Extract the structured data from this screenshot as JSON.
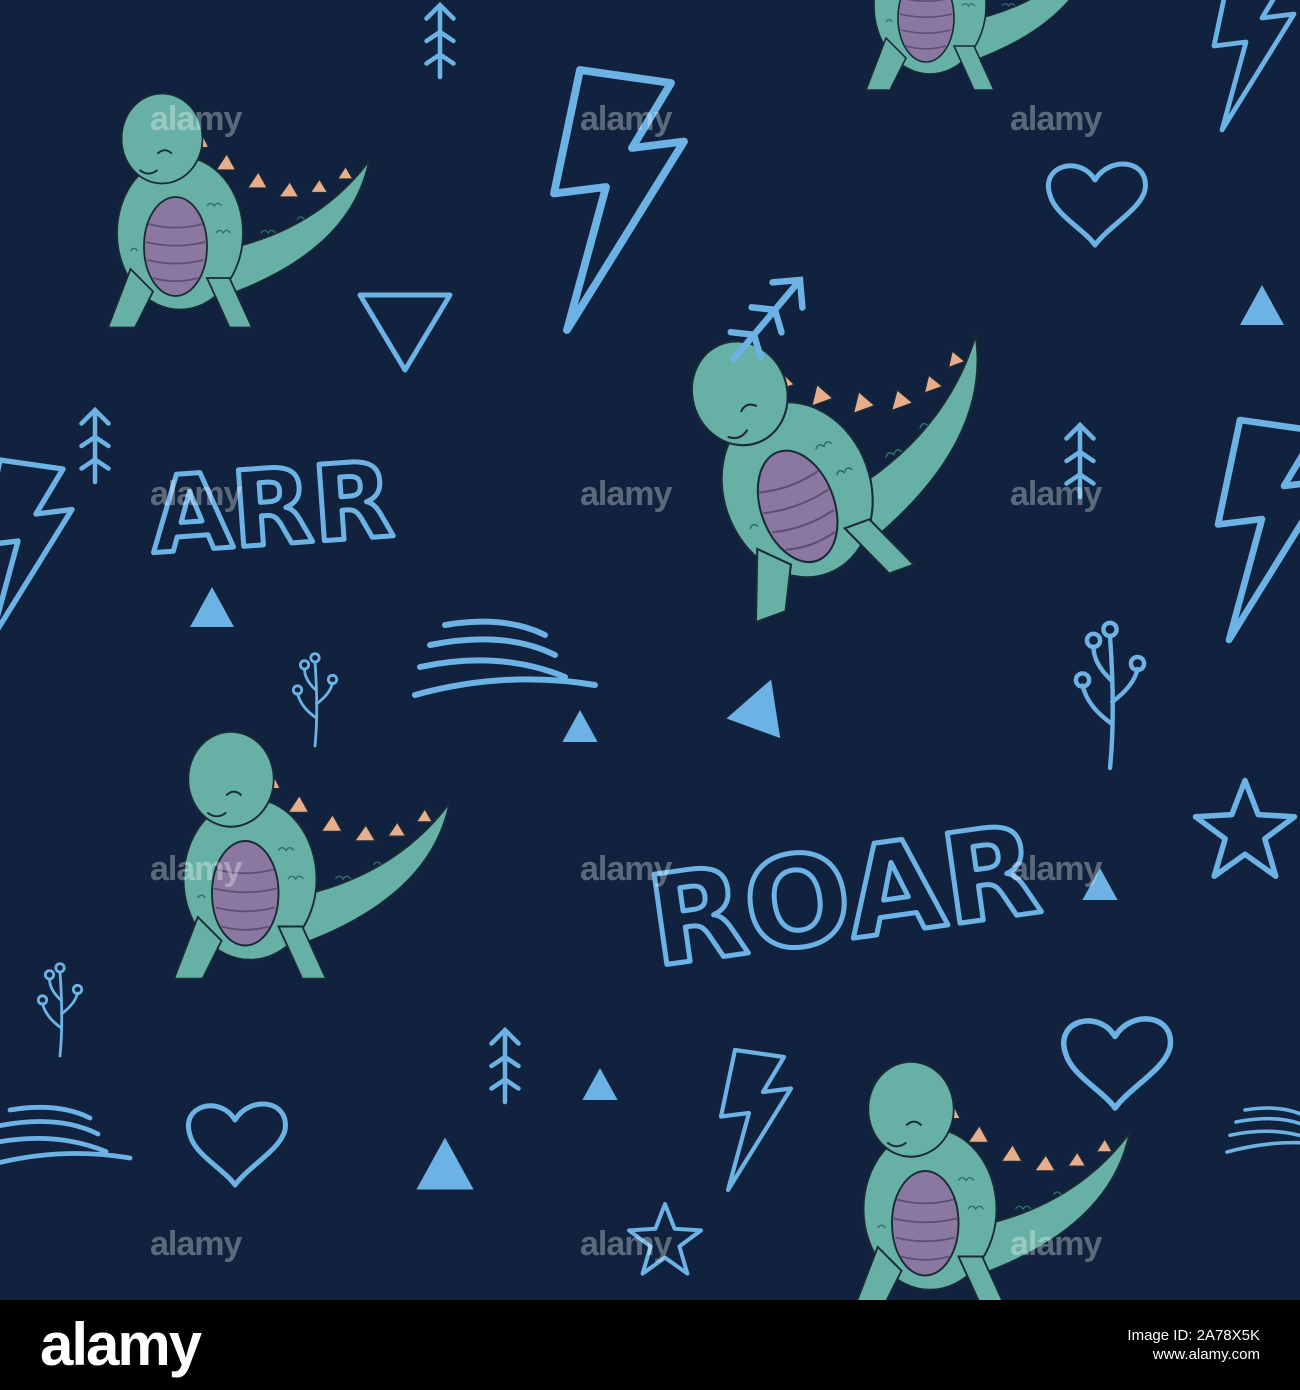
{
  "image": {
    "kind": "seamless pattern of cartoon dinosaurs on dark navy background",
    "words": [
      "ARR",
      "ROAR"
    ]
  },
  "watermark": {
    "text": "alamy"
  },
  "footer": {
    "logo": "alamy",
    "image_id_label": "Image ID: 2A78X5K",
    "image_id": "",
    "url": "www.alamy.com"
  },
  "colors": {
    "background": "#10223d",
    "doodle": "#6cb2e4",
    "dino_body": "#67b0a6",
    "dino_belly": "#8a78a0",
    "dino_spikes": "#e8ae8c",
    "outline": "#1a2a36",
    "footer_bg": "#000000"
  },
  "icons": [
    "dinosaur-illustration",
    "lightning-bolt-icon",
    "heart-icon",
    "arrow-icon",
    "triangle-icon",
    "star-icon",
    "sprig-icon",
    "speed-lines-icon"
  ]
}
